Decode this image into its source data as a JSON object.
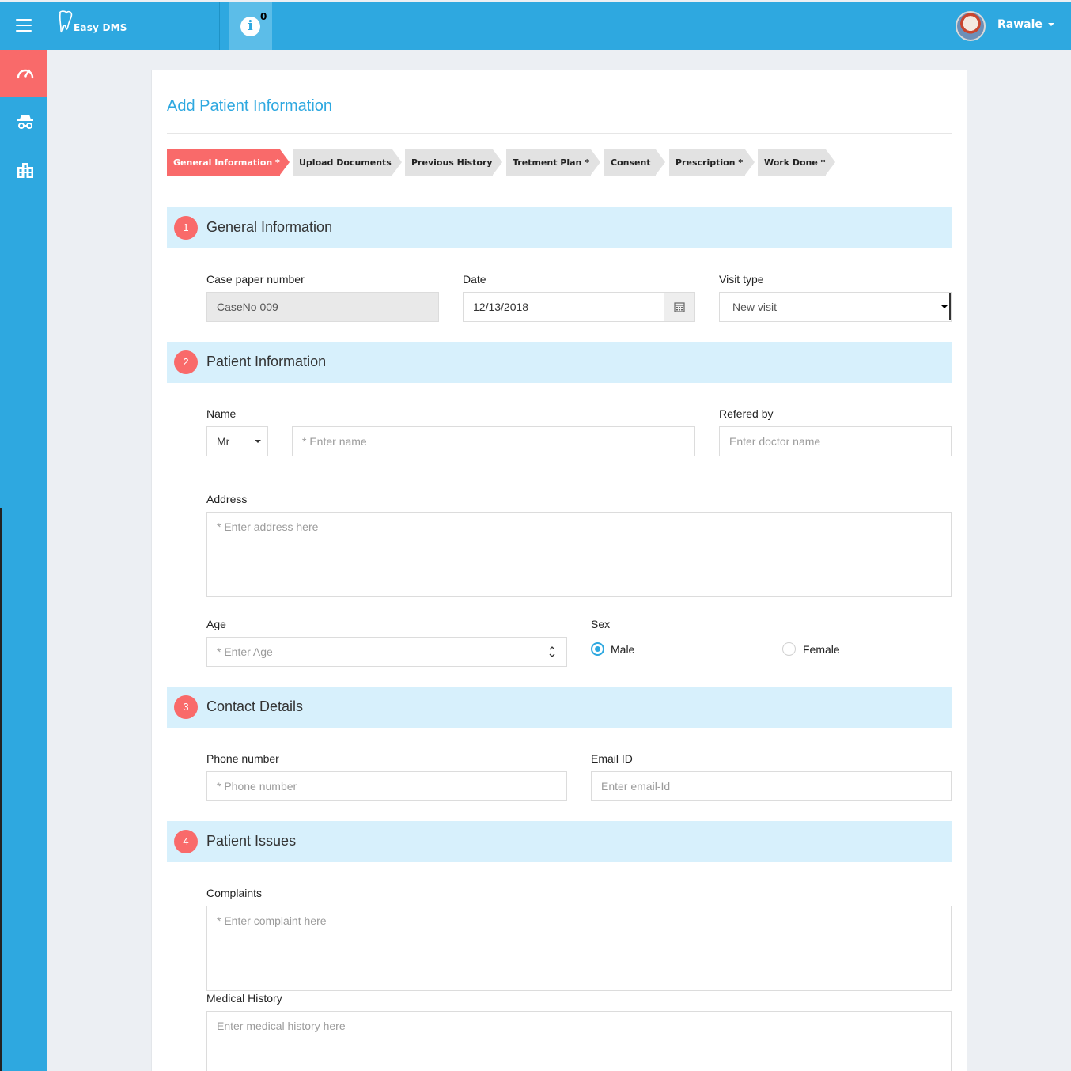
{
  "header": {
    "brand_prefix": "Easy",
    "brand_suffix": "DMS",
    "notification_count": "0",
    "user_name": "Rawale"
  },
  "sidebar": {
    "items": [
      {
        "icon": "dashboard-gauge-icon",
        "active": true
      },
      {
        "icon": "incognito-user-icon",
        "active": false
      },
      {
        "icon": "building-icon",
        "active": false
      }
    ]
  },
  "page": {
    "title": "Add Patient Information"
  },
  "steps": [
    {
      "label": "General Information *",
      "active": true
    },
    {
      "label": "Upload Documents",
      "active": false
    },
    {
      "label": "Previous History",
      "active": false
    },
    {
      "label": "Tretment Plan *",
      "active": false
    },
    {
      "label": "Consent",
      "active": false
    },
    {
      "label": "Prescription *",
      "active": false
    },
    {
      "label": "Work Done *",
      "active": false
    }
  ],
  "sections": {
    "general": {
      "number": "1",
      "title": "General Information",
      "case_label": "Case paper number",
      "case_value": "CaseNo 009",
      "date_label": "Date",
      "date_value": "12/13/2018",
      "visit_label": "Visit type",
      "visit_value": "New visit"
    },
    "patient": {
      "number": "2",
      "title": "Patient Information",
      "name_label": "Name",
      "salutation_value": "Mr",
      "name_placeholder": "* Enter name",
      "referred_label": "Refered by",
      "referred_placeholder": "Enter doctor name",
      "address_label": "Address",
      "address_placeholder": "* Enter address here",
      "age_label": "Age",
      "age_placeholder": "* Enter Age",
      "sex_label": "Sex",
      "sex_options": [
        {
          "label": "Male",
          "checked": true
        },
        {
          "label": "Female",
          "checked": false
        }
      ]
    },
    "contact": {
      "number": "3",
      "title": "Contact Details",
      "phone_label": "Phone number",
      "phone_placeholder": "* Phone number",
      "email_label": "Email ID",
      "email_placeholder": "Enter email-Id"
    },
    "issues": {
      "number": "4",
      "title": "Patient Issues",
      "complaints_label": "Complaints",
      "complaints_placeholder": "* Enter complaint here",
      "medical_label": "Medical History",
      "medical_placeholder": "Enter medical history here"
    }
  },
  "colors": {
    "primary": "#2ea8e0",
    "accent": "#f96a6a",
    "section_bg": "#d7f0fc"
  }
}
